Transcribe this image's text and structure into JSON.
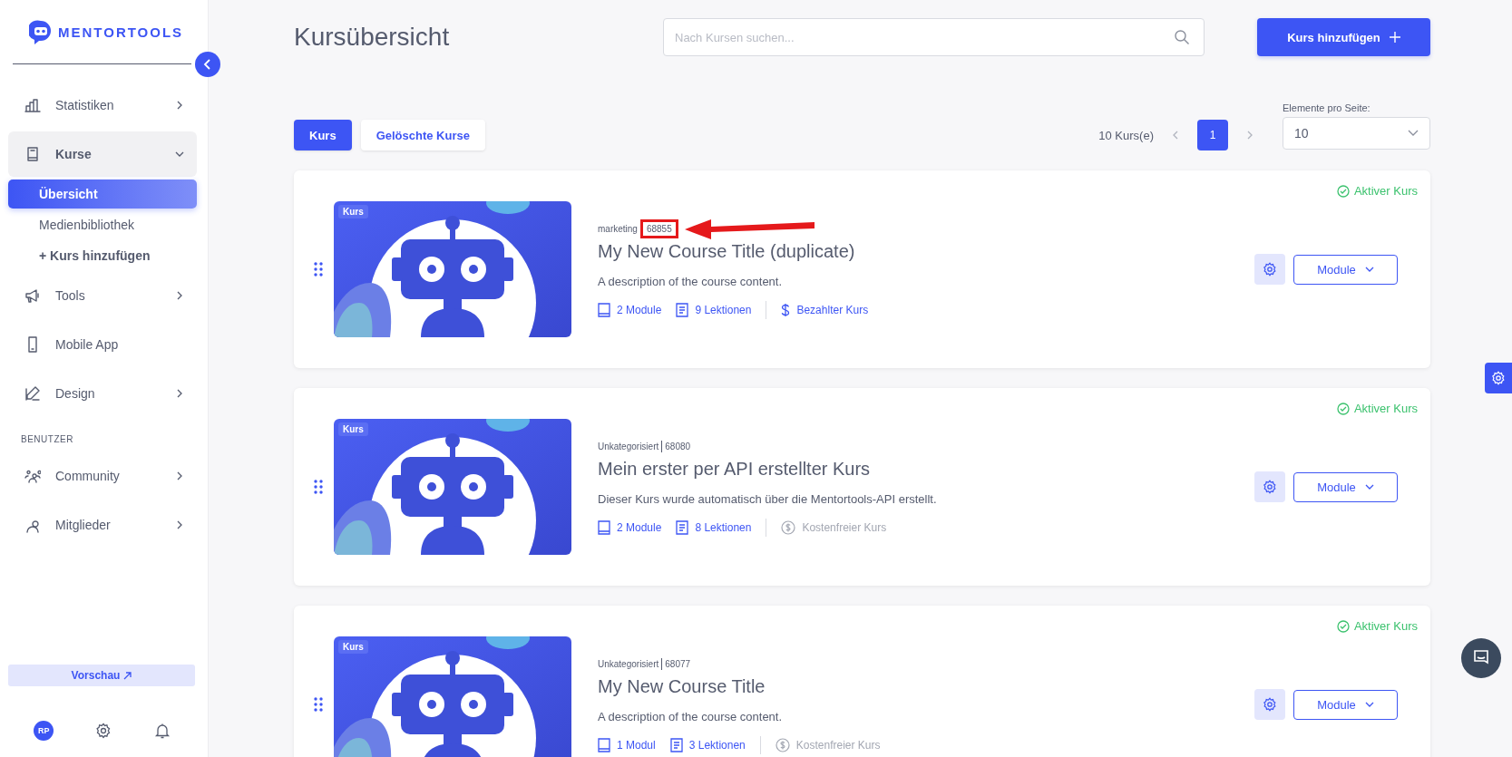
{
  "sidebar": {
    "logo": "MENTORTOOLS",
    "sections": [
      {
        "items": [
          {
            "label": "Statistiken",
            "expandable": true,
            "expanded": false
          },
          {
            "label": "Kurse",
            "expandable": true,
            "expanded": true,
            "children": [
              {
                "label": "Übersicht",
                "selected": true,
                "kind": "link"
              },
              {
                "label": "Medienbibliothek",
                "selected": false,
                "kind": "link"
              },
              {
                "label": "+ Kurs hinzufügen",
                "selected": false,
                "kind": "action"
              }
            ]
          },
          {
            "label": "Tools",
            "expandable": true,
            "expanded": false
          },
          {
            "label": "Mobile App",
            "expandable": false,
            "expanded": false
          },
          {
            "label": "Design",
            "expandable": true,
            "expanded": false
          }
        ]
      },
      {
        "heading": "BENUTZER",
        "items": [
          {
            "label": "Community",
            "expandable": true,
            "expanded": false
          },
          {
            "label": "Mitglieder",
            "expandable": true,
            "expanded": false
          }
        ]
      }
    ],
    "preview_button": "Vorschau",
    "avatar": "RP"
  },
  "header": {
    "title": "Kursübersicht",
    "search": {
      "placeholder": "Nach Kursen suchen..."
    },
    "add_button": "Kurs hinzufügen"
  },
  "toolbar": {
    "tabs": [
      {
        "label": "Kurs",
        "selected": true
      },
      {
        "label": "Gelöschte Kurse",
        "selected": false
      }
    ],
    "count": "10 Kurs(e)",
    "pages": [
      {
        "label": "1",
        "selected": true
      }
    ],
    "per_page": {
      "label": "Elemente pro Seite:",
      "value": "10"
    }
  },
  "courses": [
    {
      "badge": "Kurs",
      "category": "marketing",
      "id": "68855",
      "id_highlighted": true,
      "title": "My New Course Title (duplicate)",
      "description": "A description of the course content.",
      "modules": "2 Module",
      "lessons": "9 Lektionen",
      "pricing": {
        "label": "Bezahlter Kurs",
        "kind": "paid"
      },
      "status": "Aktiver Kurs",
      "button": "Module"
    },
    {
      "badge": "Kurs",
      "category": "Unkategorisiert",
      "id": "68080",
      "id_highlighted": false,
      "title": "Mein erster per API erstellter Kurs",
      "description": "Dieser Kurs wurde automatisch über die Mentortools-API erstellt.",
      "modules": "2 Module",
      "lessons": "8 Lektionen",
      "pricing": {
        "label": "Kostenfreier Kurs",
        "kind": "free"
      },
      "status": "Aktiver Kurs",
      "button": "Module"
    },
    {
      "badge": "Kurs",
      "category": "Unkategorisiert",
      "id": "68077",
      "id_highlighted": false,
      "title": "My New Course Title",
      "description": "A description of the course content.",
      "modules": "1 Modul",
      "lessons": "3 Lektionen",
      "pricing": {
        "label": "Kostenfreier Kurs",
        "kind": "free"
      },
      "status": "Aktiver Kurs",
      "button": "Module"
    }
  ]
}
